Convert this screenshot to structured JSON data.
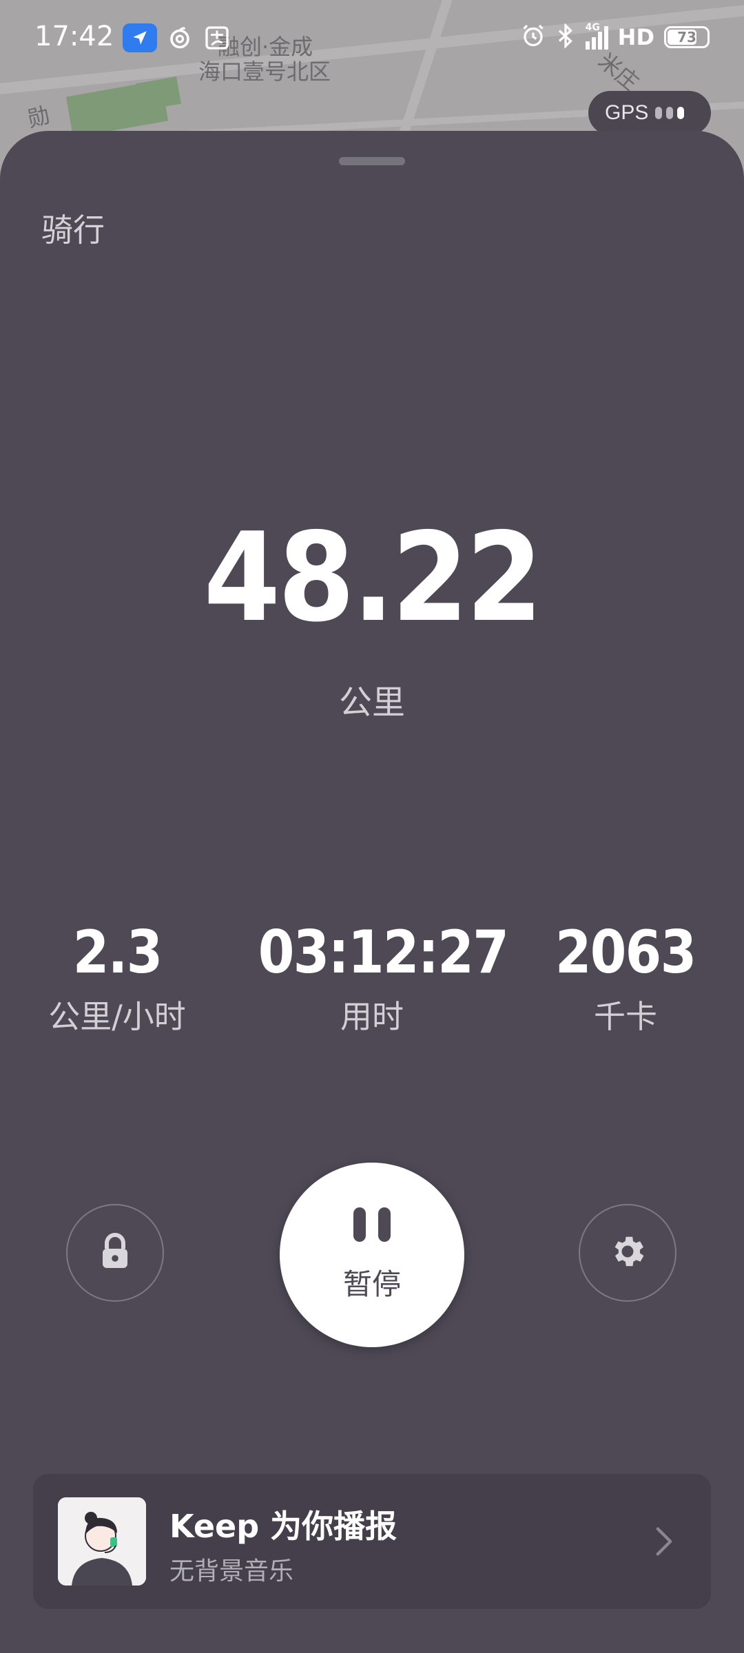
{
  "status_bar": {
    "time": "17:42",
    "network_type": "4G",
    "hd": "HD",
    "battery": "73"
  },
  "map": {
    "labels": [
      "融创·金成",
      "海口壹号北区",
      "勋",
      "米庄"
    ]
  },
  "gps": {
    "label": "GPS"
  },
  "workout": {
    "mode": "骑行",
    "distance": "48.22",
    "distance_unit": "公里",
    "metrics": [
      {
        "value": "2.3",
        "label": "公里/小时"
      },
      {
        "value": "03:12:27",
        "label": "用时"
      },
      {
        "value": "2063",
        "label": "千卡"
      }
    ],
    "pause_label": "暂停"
  },
  "voice_card": {
    "title": "Keep 为你播报",
    "subtitle": "无背景音乐"
  },
  "colors": {
    "sheet_bg": "#4e4955",
    "card_bg": "#443f4b",
    "accent_white": "#ffffff"
  },
  "icons": {
    "lock": "lock-icon",
    "settings": "gear-icon",
    "pause": "pause-icon",
    "chevron": "chevron-right-icon"
  }
}
